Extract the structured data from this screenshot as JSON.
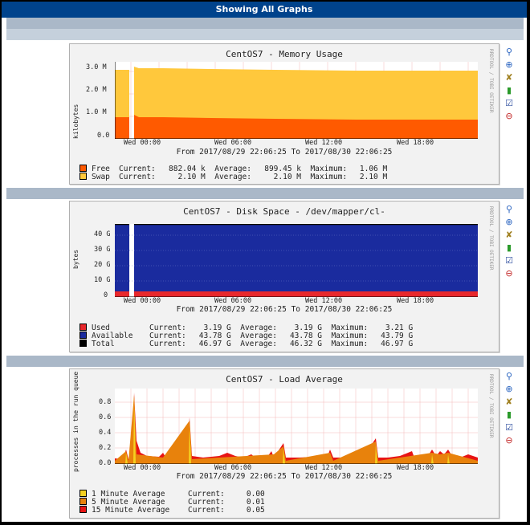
{
  "page": {
    "title": "Showing All Graphs"
  },
  "icons": [
    {
      "name": "zoom-icon",
      "glyph": "🔍"
    },
    {
      "name": "drilldown-icon",
      "glyph": "⊕"
    },
    {
      "name": "edit-wrench-icon",
      "glyph": "🔧"
    },
    {
      "name": "bar-graph-icon",
      "glyph": "📊"
    },
    {
      "name": "properties-icon",
      "glyph": "☑"
    },
    {
      "name": "delete-icon",
      "glyph": "⊖"
    }
  ],
  "graphs": [
    {
      "title": "CentOS7 - Memory Usage",
      "ylabel": "kilobytes",
      "yticks": [
        "3.0 M",
        "2.0 M",
        "1.0 M",
        "0.0"
      ],
      "xticks": [
        "Wed 00:00",
        "Wed 06:00",
        "Wed 12:00",
        "Wed 18:00"
      ],
      "watermark": "RRDTOOL / TOBI OETIKER",
      "range": "From 2017/08/29 22:06:25 To 2017/08/30 22:06:25",
      "legend": [
        {
          "color": "#ff5a00",
          "label": "Free",
          "current": "882.04 k",
          "average": "899.45 k",
          "maximum": "1.06 M"
        },
        {
          "color": "#ffc83c",
          "label": "Swap",
          "current": "2.10 M",
          "average": "2.10 M",
          "maximum": "2.10 M"
        }
      ]
    },
    {
      "title": "CentOS7 - Disk Space - /dev/mapper/cl-",
      "ylabel": "bytes",
      "yticks": [
        "40 G",
        "30 G",
        "20 G",
        "10 G",
        "0"
      ],
      "xticks": [
        "Wed 00:00",
        "Wed 06:00",
        "Wed 12:00",
        "Wed 18:00"
      ],
      "watermark": "RRDTOOL / TOBI OETIKER",
      "range": "From 2017/08/29 22:06:25 To 2017/08/30 22:06:25",
      "legend": [
        {
          "color": "#e8282c",
          "label": "Used",
          "current": "3.19 G",
          "average": "3.19 G",
          "maximum": "3.21 G"
        },
        {
          "color": "#1a2b9e",
          "label": "Available",
          "current": "43.78 G",
          "average": "43.78 G",
          "maximum": "43.79 G"
        },
        {
          "color": "#000000",
          "label": "Total",
          "current": "46.97 G",
          "average": "46.32 G",
          "maximum": "46.97 G"
        }
      ]
    },
    {
      "title": "CentOS7 - Load Average",
      "ylabel": "processes in the run queue",
      "yticks": [
        "0.8",
        "0.6",
        "0.4",
        "0.2",
        "0.0"
      ],
      "xticks": [
        "Wed 00:00",
        "Wed 06:00",
        "Wed 12:00",
        "Wed 18:00"
      ],
      "watermark": "RRDTOOL / TOBI OETIKER",
      "range": "From 2017/08/29 22:06:25 To 2017/08/30 22:06:25",
      "legend": [
        {
          "color": "#f5d020",
          "label": "1 Minute Average",
          "current": "0.00"
        },
        {
          "color": "#e8820c",
          "label": "5 Minute Average",
          "current": "0.01"
        },
        {
          "color": "#e81414",
          "label": "15 Minute Average",
          "current": "0.05"
        }
      ]
    }
  ],
  "labels": {
    "current": "Current:",
    "average": "Average:",
    "maximum": "Maximum:"
  }
}
